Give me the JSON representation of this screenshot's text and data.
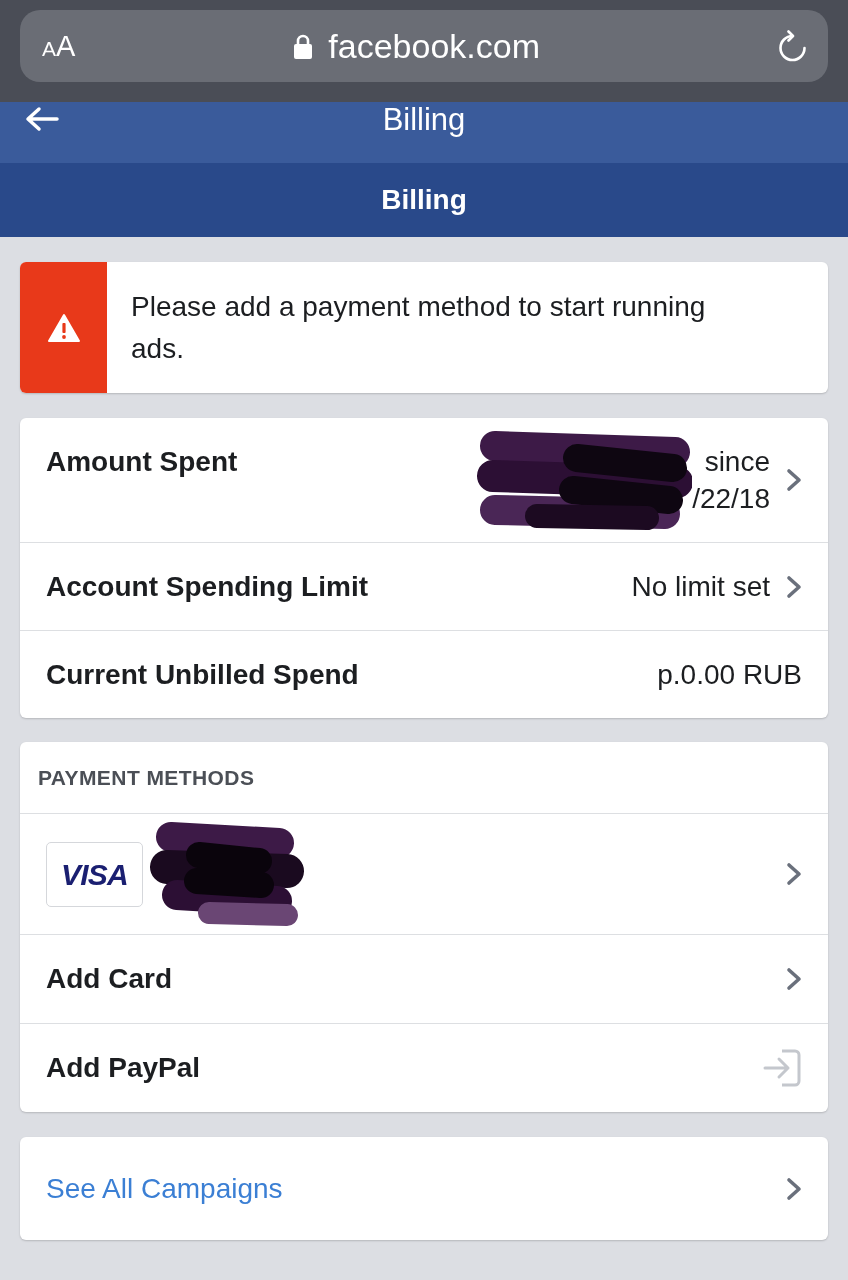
{
  "browser": {
    "text_size_button": "AA",
    "url": "facebook.com"
  },
  "nav_bar": {
    "title": "Billing"
  },
  "page_title": "Billing",
  "alert": {
    "message": "Please add a payment method to start running ads."
  },
  "summary_rows": [
    {
      "label": "Amount Spent",
      "value_lines": [
        "since",
        "/22/18"
      ],
      "redacted": true,
      "chevron": true
    },
    {
      "label": "Account Spending Limit",
      "value_lines": [
        "No limit set"
      ],
      "redacted": false,
      "chevron": true
    },
    {
      "label": "Current Unbilled Spend",
      "value_lines": [
        "p.0.00 RUB"
      ],
      "redacted": false,
      "chevron": false
    }
  ],
  "payment_methods": {
    "heading": "PAYMENT METHODS",
    "items": [
      {
        "kind": "card",
        "brand": "VISA",
        "redacted": true
      },
      {
        "kind": "link",
        "label": "Add Card"
      },
      {
        "kind": "external",
        "label": "Add PayPal"
      }
    ]
  },
  "campaigns_link": {
    "label": "See All Campaigns",
    "chevron": true
  }
}
